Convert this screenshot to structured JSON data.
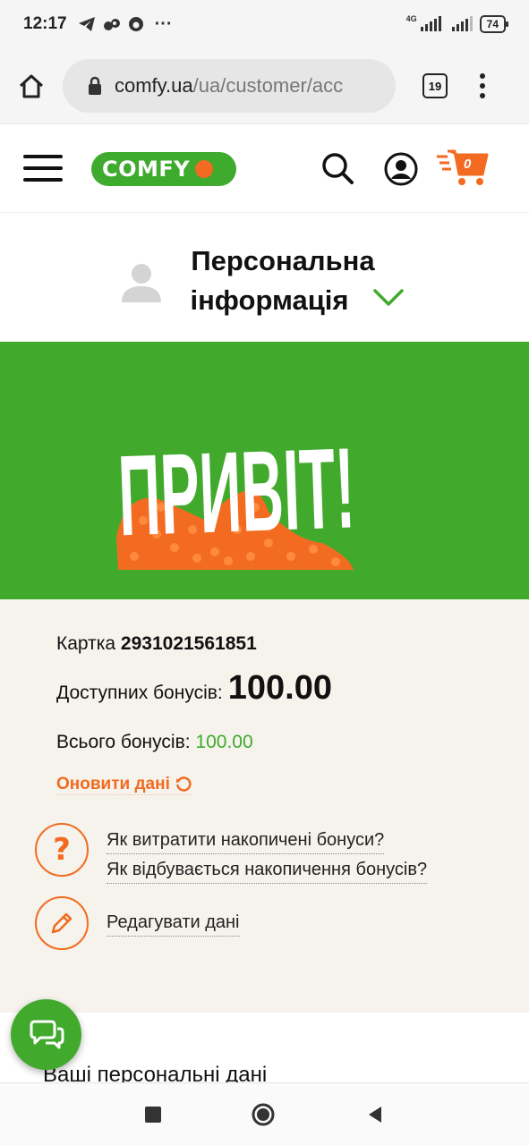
{
  "status_bar": {
    "time": "12:17",
    "network_label": "4G",
    "battery": "74",
    "icons": [
      "telegram-icon",
      "app-icon",
      "app-icon-2",
      "more-notifications-icon"
    ]
  },
  "browser": {
    "url_domain": "comfy.ua",
    "url_path": "/ua/customer/acc",
    "tabs_count": "19"
  },
  "header": {
    "logo_text": "COMFY",
    "cart_count": "0",
    "brand_green": "#41aa2d",
    "brand_orange": "#f26b21"
  },
  "personal_info": {
    "title_line1": "Персональна",
    "title_line2": "інформація"
  },
  "banner": {
    "text": "ПРИВІТ!"
  },
  "bonus": {
    "card_label": "Картка",
    "card_number": "2931021561851",
    "available_label": "Доступних бонусів:",
    "available_value": "100.00",
    "total_label": "Всього бонусів:",
    "total_value": "100.00",
    "refresh_label": "Оновити дані",
    "help_link1": "Як витратити накопичені бонуси?",
    "help_link2": "Як відбувається накопичення бонусів?",
    "edit_label": "Редагувати дані"
  },
  "personal_data": {
    "title": "Ваші персональні дані"
  }
}
